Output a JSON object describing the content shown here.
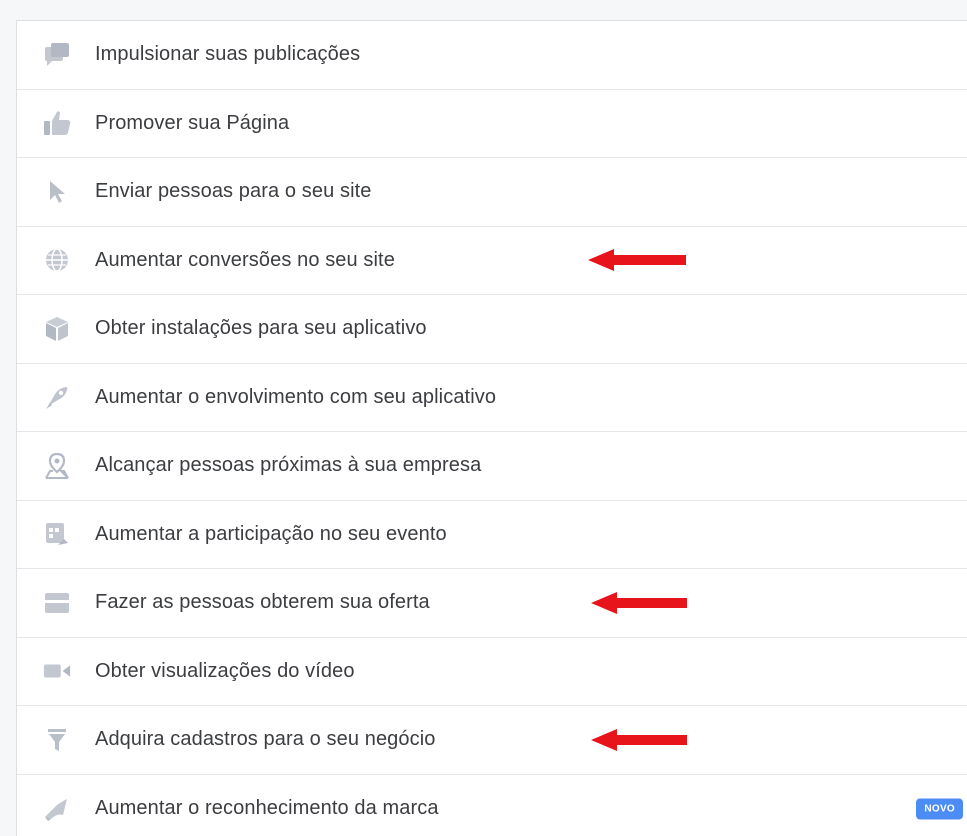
{
  "menu": {
    "items": [
      {
        "label": "Impulsionar suas publicações",
        "icon": "boost-posts-icon"
      },
      {
        "label": "Promover sua Página",
        "icon": "thumbs-up-icon"
      },
      {
        "label": "Enviar pessoas para o seu site",
        "icon": "cursor-icon"
      },
      {
        "label": "Aumentar conversões no seu site",
        "icon": "globe-icon"
      },
      {
        "label": "Obter instalações para seu aplicativo",
        "icon": "app-box-icon"
      },
      {
        "label": "Aumentar o envolvimento com seu aplicativo",
        "icon": "engagement-icon"
      },
      {
        "label": "Alcançar pessoas próximas à sua empresa",
        "icon": "location-pin-icon"
      },
      {
        "label": "Aumentar a participação no seu evento",
        "icon": "calendar-icon"
      },
      {
        "label": "Fazer as pessoas obterem sua oferta",
        "icon": "offer-icon"
      },
      {
        "label": "Obter visualizações do vídeo",
        "icon": "video-camera-icon"
      },
      {
        "label": "Adquira cadastros para o seu negócio",
        "icon": "funnel-icon"
      },
      {
        "label": "Aumentar o reconhecimento da marca",
        "icon": "megaphone-icon",
        "badge": "NOVO"
      }
    ]
  },
  "colors": {
    "icon": "#b9bfc9",
    "arrow": "#e8141b",
    "badge": "#4c8cf5",
    "text": "#3b3d41"
  }
}
